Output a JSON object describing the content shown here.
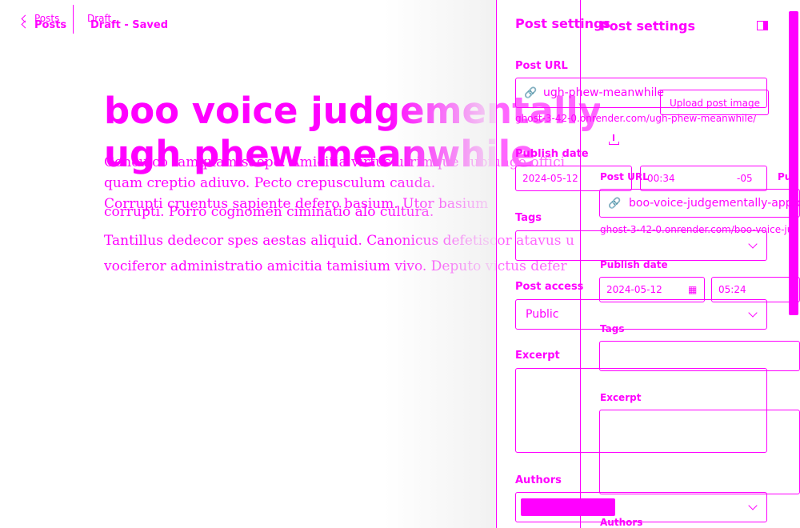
{
  "nav": {
    "back_label_top": "Posts",
    "back_label": "Posts",
    "status_top": "Draft",
    "status": "Draft - Saved"
  },
  "editor": {
    "title_line1": "boo voice judgementally apr",
    "title_line2": "ugh phew meanwhile",
    "body_under": [
      "Conculco tamquam saepe. Amicitia virtus utrimque subiungo offici",
      "quam creptio adiuvo. Pecto crepusculum cauda.",
      "corrupti. Porro cognomen ciminatio alo cultura."
    ],
    "body": [
      "Corrupti cruentus sapiente defero basium. Utor basium",
      "Tantillus dedecor spes aestas aliquid. Canonicus defetiscor atavus u",
      "vociferor administratio amicitia tamisium vivo. Deputo victus defer"
    ]
  },
  "back_panel": {
    "title": "Post settings",
    "post_url_label": "Post URL",
    "post_url_value": "ugh-phew-meanwhile",
    "post_url_hint": "ghost-3-42-0.onrender.com/ugh-phew-meanwhile/",
    "publish_date_label": "Publish date",
    "publish_date": "2024-05-12",
    "publish_time": "00:34",
    "timezone": "-05",
    "tags_label": "Tags",
    "post_access_label": "Post access",
    "post_access_value": "Public",
    "excerpt_label": "Excerpt",
    "authors_label": "Authors"
  },
  "front_panel": {
    "title": "Post settings",
    "upload_image_label": "Upload post image",
    "post_url_label": "Post URL",
    "post_url_value": "boo-voice-judgementally-approa",
    "post_url_hint": "ghost-3-42-0.onrender.com/boo-voice-ju",
    "publish_date_label": "Publish date",
    "publish_date": "2024-05-12",
    "publish_time": "05:24",
    "tags_label": "Tags",
    "excerpt_label": "Excerpt",
    "authors_label": "Authors",
    "clipped_label": "Pu"
  },
  "colors": {
    "accent": "#ff00ff",
    "background": "#ffffff"
  },
  "icons": [
    "chevron-left-icon",
    "link-icon",
    "calendar-icon",
    "chevron-down-icon",
    "panel-toggle-icon",
    "upload-icon"
  ]
}
